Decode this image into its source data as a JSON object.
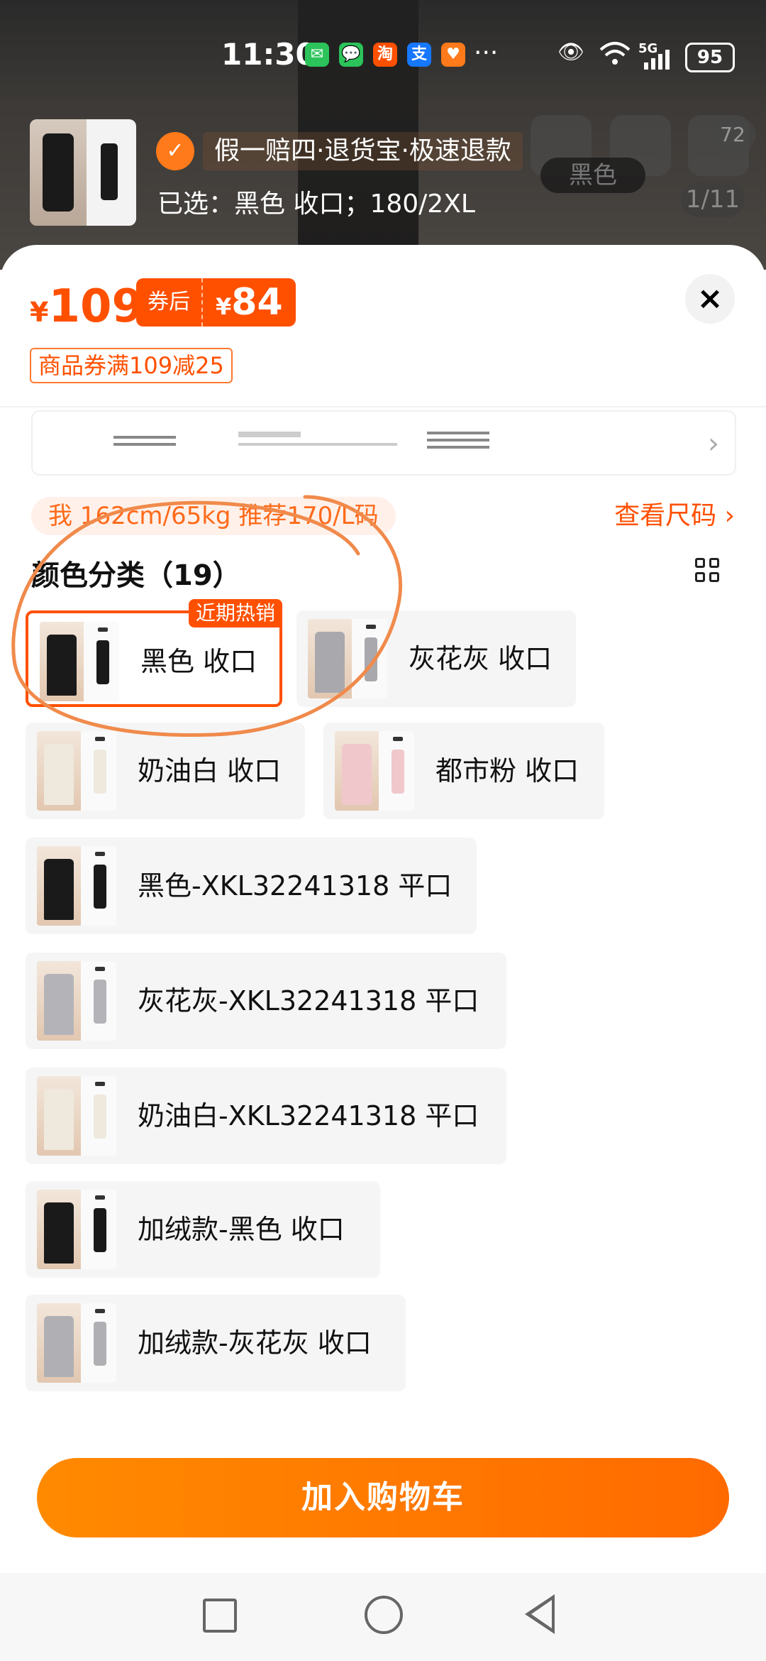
{
  "status_bar": {
    "time": "11:30",
    "battery": "95",
    "network": "5G",
    "more": "···",
    "app_icons": [
      {
        "name": "wechat-icon",
        "glyph": "✉",
        "color": "#2bc35a"
      },
      {
        "name": "messages-icon",
        "glyph": "💬",
        "color": "#2bc35a"
      },
      {
        "name": "taobao-icon",
        "glyph": "淘",
        "color": "#ff5000"
      },
      {
        "name": "alipay-icon",
        "glyph": "支",
        "color": "#1677ff"
      },
      {
        "name": "app-icon",
        "glyph": "♥",
        "color": "#ff7a1a"
      }
    ]
  },
  "background": {
    "pager": "1/11",
    "color_tag": "黑色",
    "cart_count": "72"
  },
  "header": {
    "guarantee": "假一赔四·退货宝·极速退款",
    "selected": "已选：黑色 收口；180/2XL"
  },
  "price": {
    "currency": "¥",
    "original": "109",
    "coupon_label": "券后",
    "after_coupon": "84",
    "coupon_tag": "商品券满109减25"
  },
  "recommendation": {
    "text": "我 162cm/65kg 推荐170/L码",
    "size_chart_link": "查看尺码 ›"
  },
  "colors": {
    "title": "颜色分类（19）",
    "hot_badge": "近期热销",
    "options": [
      {
        "label": "黑色 收口",
        "pant": "#1a1a1a"
      },
      {
        "label": "灰花灰 收口",
        "pant": "#a9a9ad"
      },
      {
        "label": "奶油白 收口",
        "pant": "#efe9dd"
      },
      {
        "label": "都市粉 收口",
        "pant": "#f0c8cc"
      },
      {
        "label": "黑色-XKL32241318 平口",
        "pant": "#1a1a1a"
      },
      {
        "label": "灰花灰-XKL32241318 平口",
        "pant": "#b4b4b8"
      },
      {
        "label": "奶油白-XKL32241318 平口",
        "pant": "#efe9dd"
      },
      {
        "label": "加绒款-黑色 收口",
        "pant": "#1a1a1a"
      },
      {
        "label": "加绒款-灰花灰 收口",
        "pant": "#b0b0b4"
      }
    ]
  },
  "actions": {
    "close": "×",
    "add_to_cart": "加入购物车"
  },
  "colors_theme": {
    "accent": "#ff5000",
    "button": "#ff7a00",
    "annotation": "#f08a4b"
  }
}
